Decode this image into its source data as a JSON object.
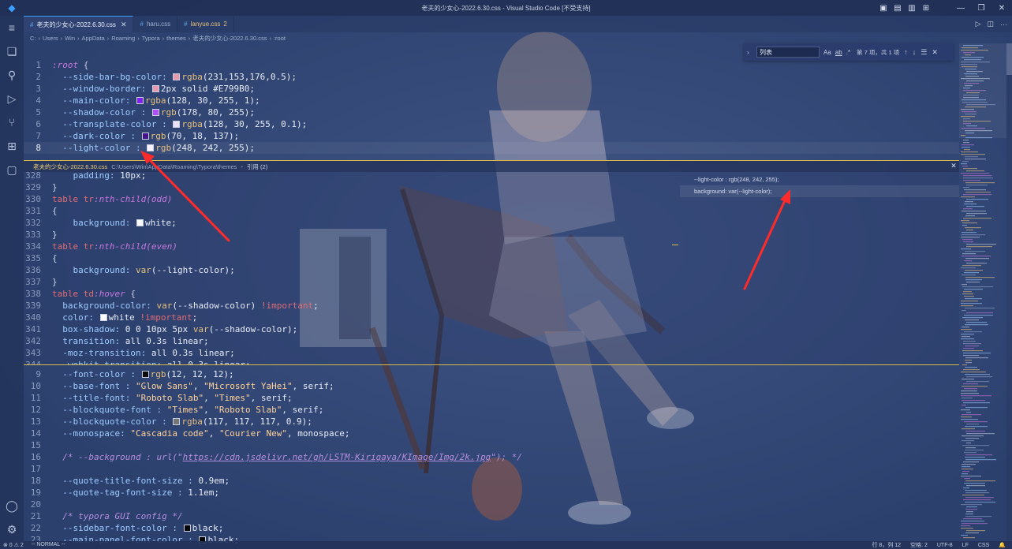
{
  "window": {
    "title": "老夫的少女心-2022.6.30.css - Visual Studio Code [不受支持]"
  },
  "tabs": [
    {
      "label": "老夫的少女心-2022.6.30.css",
      "close": "✕"
    },
    {
      "label": "haru.css"
    },
    {
      "label": "lanyue.css",
      "badge": "2"
    }
  ],
  "breadcrumb": [
    "C:",
    "Users",
    "Win",
    "AppData",
    "Roaming",
    "Typora",
    "themes",
    "老夫的少女心-2022.6.30.css",
    ":root"
  ],
  "find": {
    "query": "列表",
    "opt_case": "Aa",
    "opt_word": "ab",
    "opt_regex": ".*",
    "count": "第 7 项，共 1 项"
  },
  "peek": {
    "file": "老夫的少女心-2022.6.30.css",
    "path": "C:\\Users\\Win\\AppData\\Roaming\\Typora\\themes",
    "sep": "-",
    "refs_label": "引用 (2)",
    "references": [
      "--light-color : rgb(248, 242, 255);",
      "background: var(--light-color);"
    ]
  },
  "code_top": [
    {
      "n": "1",
      "t": ":root {"
    },
    {
      "n": "2",
      "t": "  --side-bar-bg-color: rgba(231,153,176,0.5);",
      "swatch": "#e799b0"
    },
    {
      "n": "3",
      "t": "  --window-border: 2px solid #E799B0;",
      "swatch": "#e799b0"
    },
    {
      "n": "4",
      "t": "  --main-color: rgba(128, 30, 255, 1);",
      "swatch": "#801eff"
    },
    {
      "n": "5",
      "t": "  --shadow-color : rgb(178, 80, 255);",
      "swatch": "#b250ff"
    },
    {
      "n": "6",
      "t": "  --transplate-color : rgba(128, 30, 255, 0.1);",
      "swatch": "#ece3fb"
    },
    {
      "n": "7",
      "t": "  --dark-color : rgb(70, 18, 137);",
      "swatch": "#461289"
    },
    {
      "n": "8",
      "t": "  --light-color : rgb(248, 242, 255);",
      "swatch": "#f8f2ff"
    }
  ],
  "code_peek": [
    {
      "n": "328",
      "t": "    padding: 10px;"
    },
    {
      "n": "329",
      "t": "}"
    },
    {
      "n": "330",
      "t": "table tr:nth-child(odd)"
    },
    {
      "n": "331",
      "t": "{"
    },
    {
      "n": "332",
      "t": "    background: white;",
      "swatch": "#ffffff"
    },
    {
      "n": "333",
      "t": "}"
    },
    {
      "n": "334",
      "t": "table tr:nth-child(even)"
    },
    {
      "n": "335",
      "t": "{"
    },
    {
      "n": "336",
      "t": "    background: var(--light-color);"
    },
    {
      "n": "337",
      "t": "}"
    },
    {
      "n": "338",
      "t": "table td:hover {"
    },
    {
      "n": "339",
      "t": "  background-color: var(--shadow-color) !important;"
    },
    {
      "n": "340",
      "t": "  color: white !important;",
      "swatch": "#ffffff"
    },
    {
      "n": "341",
      "t": "  box-shadow: 0 0 10px 5px var(--shadow-color);"
    },
    {
      "n": "342",
      "t": "  transition: all 0.3s linear;"
    },
    {
      "n": "343",
      "t": "  -moz-transition: all 0.3s linear;"
    },
    {
      "n": "344",
      "t": "  -webkit-transition: all 0.3s linear;"
    }
  ],
  "code_bottom": [
    {
      "n": "9",
      "t": "  --font-color : rgb(12, 12, 12);",
      "swatch": "#0c0c0c"
    },
    {
      "n": "10",
      "t": "  --base-font : \"Glow Sans\", \"Microsoft YaHei\", serif;"
    },
    {
      "n": "11",
      "t": "  --title-font: \"Roboto Slab\", \"Times\", serif;"
    },
    {
      "n": "12",
      "t": "  --blockquote-font : \"Times\", \"Roboto Slab\", serif;"
    },
    {
      "n": "13",
      "t": "  --blockquote-color : rgba(117, 117, 117, 0.9);",
      "swatch": "#757575"
    },
    {
      "n": "14",
      "t": "  --monospace: \"Cascadia code\", \"Courier New\", monospace;"
    },
    {
      "n": "15",
      "t": ""
    },
    {
      "n": "16",
      "t": "  /* --background : url(\"https://cdn.jsdelivr.net/gh/LSTM-Kirigaya/KImage/Img/2k.jpg\"); */"
    },
    {
      "n": "17",
      "t": ""
    },
    {
      "n": "18",
      "t": "  --quote-title-font-size : 0.9em;"
    },
    {
      "n": "19",
      "t": "  --quote-tag-font-size : 1.1em;"
    },
    {
      "n": "20",
      "t": ""
    },
    {
      "n": "21",
      "t": "  /* typora GUI config */"
    },
    {
      "n": "22",
      "t": "  --sidebar-font-color : black;",
      "swatch": "#000000"
    },
    {
      "n": "23",
      "t": "  --main-panel-font-color : black;",
      "swatch": "#000000"
    }
  ],
  "status": {
    "problems": "⊗ 0 ⚠ 2",
    "mode": "-- NORMAL --",
    "position": "行 8，列 12",
    "spaces": "空格: 2",
    "encoding": "UTF-8",
    "eol": "LF",
    "language": "CSS"
  },
  "colors": {
    "accent": "#3aa0ff",
    "peek_border": "#d8b94a",
    "arrow": "#ff2a2a"
  }
}
